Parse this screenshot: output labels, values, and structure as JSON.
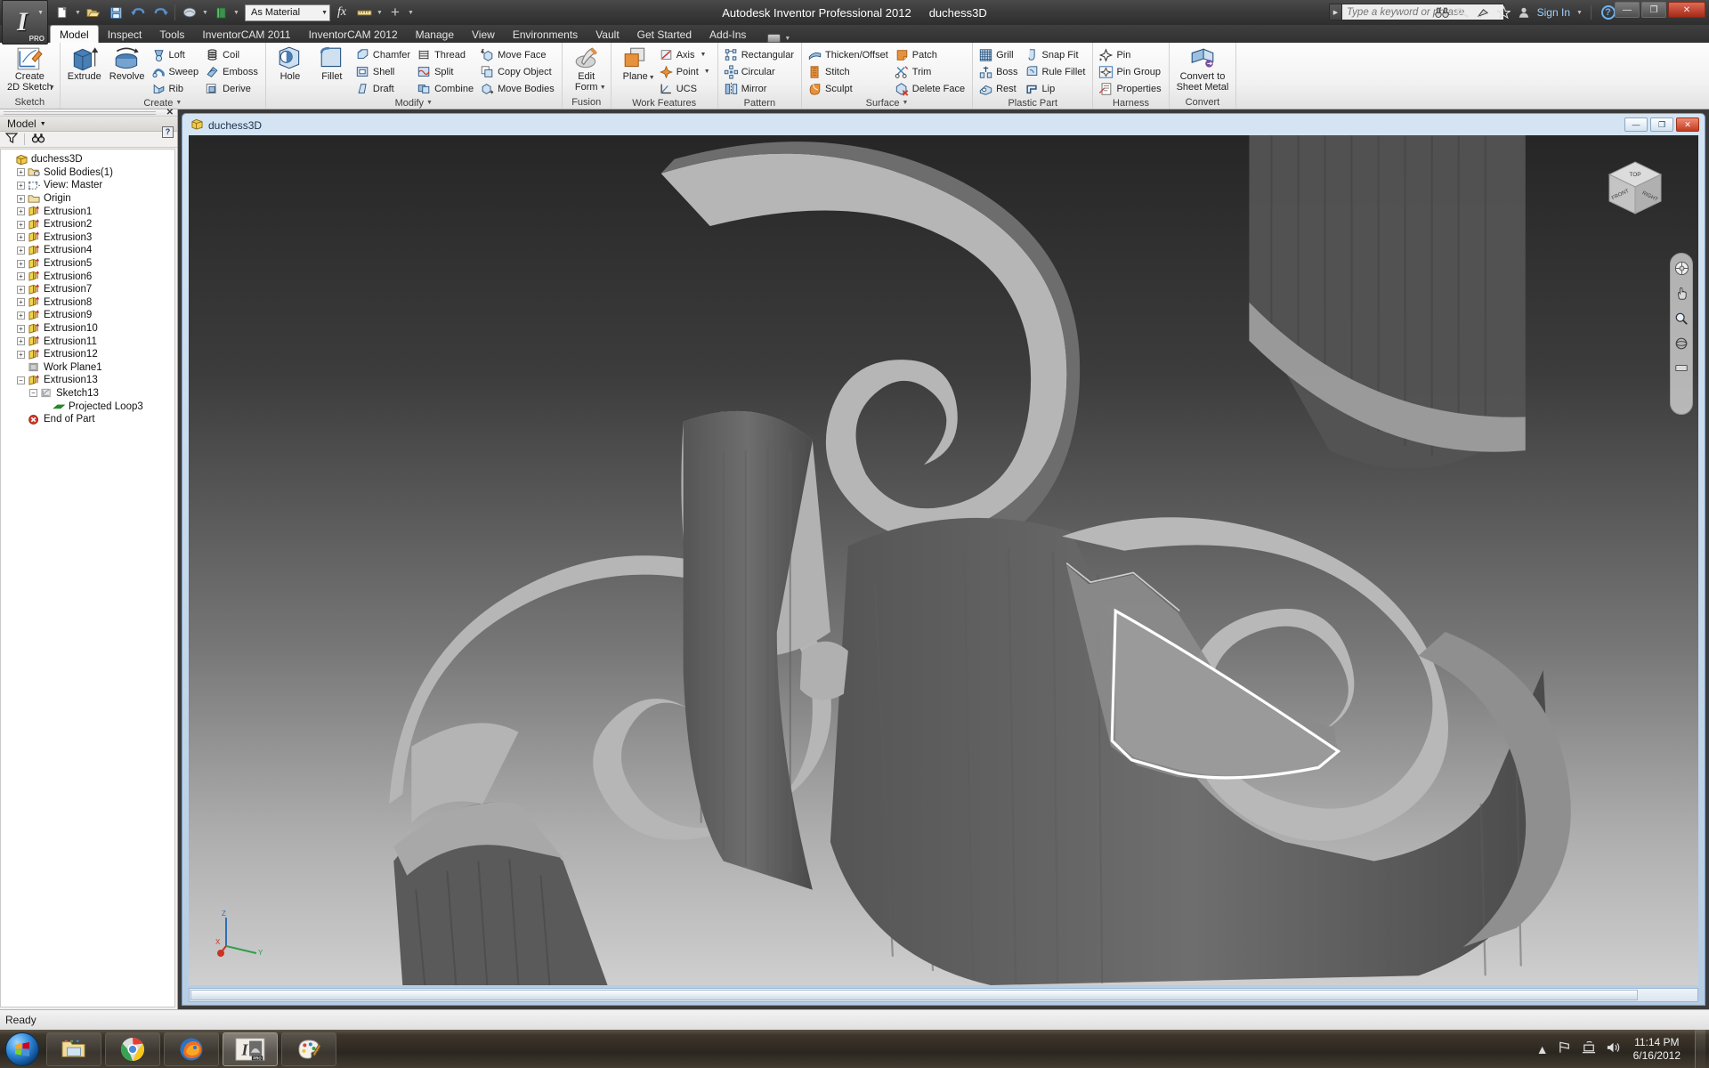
{
  "app": {
    "title_product": "Autodesk Inventor Professional 2012",
    "title_document": "duchess3D",
    "orb_label": "PRO"
  },
  "quick_access": {
    "items": [
      {
        "name": "new-file",
        "icon": "document-icon"
      },
      {
        "name": "open-file",
        "icon": "folder-open-icon"
      },
      {
        "name": "save-file",
        "icon": "floppy-disk-icon"
      },
      {
        "name": "undo",
        "icon": "undo-arrow-icon"
      },
      {
        "name": "redo",
        "icon": "redo-arrow-icon"
      },
      {
        "name": "appearance",
        "icon": "paint-icon"
      },
      {
        "name": "material-color",
        "icon": "green-book-icon"
      }
    ],
    "material_value": "As Material",
    "parameters_label": "fx",
    "measure_label": "measure-icon",
    "add_label": "+"
  },
  "search": {
    "placeholder": "Type a keyword or phrase"
  },
  "help_area": {
    "sign_in": "Sign In",
    "icons": [
      "binoculars-icon",
      "key-icon",
      "satellite-icon",
      "star-icon",
      "user-icon",
      "help-icon"
    ]
  },
  "window_buttons": {
    "minimize": "—",
    "restore": "❐",
    "close": "✕"
  },
  "tabs": [
    {
      "label": "Model",
      "active": true
    },
    {
      "label": "Inspect",
      "active": false
    },
    {
      "label": "Tools",
      "active": false
    },
    {
      "label": "InventorCAM 2011",
      "active": false
    },
    {
      "label": "InventorCAM 2012",
      "active": false
    },
    {
      "label": "Manage",
      "active": false
    },
    {
      "label": "View",
      "active": false
    },
    {
      "label": "Environments",
      "active": false
    },
    {
      "label": "Vault",
      "active": false
    },
    {
      "label": "Get Started",
      "active": false
    },
    {
      "label": "Add-Ins",
      "active": false
    }
  ],
  "ribbon": {
    "panels": [
      {
        "label": "Sketch",
        "big": [
          {
            "label": "Create\n2D Sketch",
            "icon": "sketch-icon",
            "dropdown": true
          }
        ],
        "cols": []
      },
      {
        "label": "Create",
        "dropdown": true,
        "big": [
          {
            "label": "Extrude",
            "icon": "extrude-icon"
          },
          {
            "label": "Revolve",
            "icon": "revolve-icon"
          }
        ],
        "cols": [
          [
            {
              "label": "Loft",
              "icon": "loft-icon"
            },
            {
              "label": "Sweep",
              "icon": "sweep-icon"
            },
            {
              "label": "Rib",
              "icon": "rib-icon"
            }
          ],
          [
            {
              "label": "Coil",
              "icon": "coil-icon"
            },
            {
              "label": "Emboss",
              "icon": "emboss-icon"
            },
            {
              "label": "Derive",
              "icon": "derive-icon"
            }
          ]
        ]
      },
      {
        "label": "Modify",
        "dropdown": true,
        "big": [
          {
            "label": "Hole",
            "icon": "hole-icon"
          },
          {
            "label": "Fillet",
            "icon": "fillet-icon"
          }
        ],
        "cols": [
          [
            {
              "label": "Chamfer",
              "icon": "chamfer-icon"
            },
            {
              "label": "Shell",
              "icon": "shell-icon"
            },
            {
              "label": "Draft",
              "icon": "draft-icon"
            }
          ],
          [
            {
              "label": "Thread",
              "icon": "thread-icon"
            },
            {
              "label": "Split",
              "icon": "split-icon"
            },
            {
              "label": "Combine",
              "icon": "combine-icon"
            }
          ],
          [
            {
              "label": "Move Face",
              "icon": "move-face-icon"
            },
            {
              "label": "Copy Object",
              "icon": "copy-object-icon"
            },
            {
              "label": "Move Bodies",
              "icon": "move-bodies-icon"
            }
          ]
        ]
      },
      {
        "label": "Fusion",
        "big": [
          {
            "label": "Edit\nForm",
            "icon": "edit-form-icon",
            "dropdown": true
          }
        ],
        "cols": []
      },
      {
        "label": "Work Features",
        "big": [
          {
            "label": "Plane",
            "icon": "plane-icon",
            "dropdown": true
          }
        ],
        "cols": [
          [
            {
              "label": "Axis",
              "icon": "axis-icon",
              "dropdown": true
            },
            {
              "label": "Point",
              "icon": "point-icon",
              "dropdown": true
            },
            {
              "label": "UCS",
              "icon": "ucs-icon"
            }
          ]
        ]
      },
      {
        "label": "Pattern",
        "big": [],
        "cols": [
          [
            {
              "label": "Rectangular",
              "icon": "rectangular-pattern-icon"
            },
            {
              "label": "Circular",
              "icon": "circular-pattern-icon"
            },
            {
              "label": "Mirror",
              "icon": "mirror-icon"
            }
          ]
        ]
      },
      {
        "label": "Surface",
        "dropdown": true,
        "big": [],
        "cols": [
          [
            {
              "label": "Thicken/Offset",
              "icon": "thicken-offset-icon"
            },
            {
              "label": "Stitch",
              "icon": "stitch-icon"
            },
            {
              "label": "Sculpt",
              "icon": "sculpt-icon"
            }
          ],
          [
            {
              "label": "Patch",
              "icon": "patch-icon"
            },
            {
              "label": "Trim",
              "icon": "trim-icon"
            },
            {
              "label": "Delete Face",
              "icon": "delete-face-icon"
            }
          ]
        ]
      },
      {
        "label": "Plastic Part",
        "big": [],
        "cols": [
          [
            {
              "label": "Grill",
              "icon": "grill-icon"
            },
            {
              "label": "Boss",
              "icon": "boss-icon"
            },
            {
              "label": "Rest",
              "icon": "rest-icon"
            }
          ],
          [
            {
              "label": "Snap Fit",
              "icon": "snap-fit-icon"
            },
            {
              "label": "Rule Fillet",
              "icon": "rule-fillet-icon"
            },
            {
              "label": "Lip",
              "icon": "lip-icon"
            }
          ]
        ]
      },
      {
        "label": "Harness",
        "big": [],
        "cols": [
          [
            {
              "label": "Pin",
              "icon": "pin-icon"
            },
            {
              "label": "Pin Group",
              "icon": "pin-group-icon"
            },
            {
              "label": "Properties",
              "icon": "properties-icon"
            }
          ]
        ]
      },
      {
        "label": "Convert",
        "big": [
          {
            "label": "Convert to\nSheet Metal",
            "icon": "convert-sheet-metal-icon"
          }
        ],
        "cols": []
      }
    ]
  },
  "browser": {
    "title": "Model",
    "tools": [
      "filter-icon",
      "find-icon"
    ],
    "tree": [
      {
        "label": "duchess3D",
        "depth": 0,
        "expander": "none",
        "icon": "part-icon"
      },
      {
        "label": "Solid Bodies(1)",
        "depth": 1,
        "expander": "plus",
        "icon": "solid-bodies-icon"
      },
      {
        "label": "View: Master",
        "depth": 1,
        "expander": "plus",
        "icon": "view-icon"
      },
      {
        "label": "Origin",
        "depth": 1,
        "expander": "plus",
        "icon": "folder-icon"
      },
      {
        "label": "Extrusion1",
        "depth": 1,
        "expander": "plus",
        "icon": "extrusion-icon"
      },
      {
        "label": "Extrusion2",
        "depth": 1,
        "expander": "plus",
        "icon": "extrusion-icon"
      },
      {
        "label": "Extrusion3",
        "depth": 1,
        "expander": "plus",
        "icon": "extrusion-icon"
      },
      {
        "label": "Extrusion4",
        "depth": 1,
        "expander": "plus",
        "icon": "extrusion-icon"
      },
      {
        "label": "Extrusion5",
        "depth": 1,
        "expander": "plus",
        "icon": "extrusion-icon"
      },
      {
        "label": "Extrusion6",
        "depth": 1,
        "expander": "plus",
        "icon": "extrusion-icon"
      },
      {
        "label": "Extrusion7",
        "depth": 1,
        "expander": "plus",
        "icon": "extrusion-icon"
      },
      {
        "label": "Extrusion8",
        "depth": 1,
        "expander": "plus",
        "icon": "extrusion-icon"
      },
      {
        "label": "Extrusion9",
        "depth": 1,
        "expander": "plus",
        "icon": "extrusion-icon"
      },
      {
        "label": "Extrusion10",
        "depth": 1,
        "expander": "plus",
        "icon": "extrusion-icon"
      },
      {
        "label": "Extrusion11",
        "depth": 1,
        "expander": "plus",
        "icon": "extrusion-icon"
      },
      {
        "label": "Extrusion12",
        "depth": 1,
        "expander": "plus",
        "icon": "extrusion-icon"
      },
      {
        "label": "Work Plane1",
        "depth": 1,
        "expander": "none",
        "icon": "work-plane-icon"
      },
      {
        "label": "Extrusion13",
        "depth": 1,
        "expander": "minus",
        "icon": "extrusion-icon"
      },
      {
        "label": "Sketch13",
        "depth": 2,
        "expander": "minus",
        "icon": "sketch-node-icon"
      },
      {
        "label": "Projected Loop3",
        "depth": 3,
        "expander": "none",
        "icon": "projected-loop-icon"
      },
      {
        "label": "End of Part",
        "depth": 1,
        "expander": "none",
        "icon": "end-of-part-icon"
      }
    ]
  },
  "document_window": {
    "title": "duchess3D",
    "buttons": {
      "minimize": "—",
      "restore": "❐",
      "close": "✕"
    }
  },
  "viewcube": {
    "face_top": "TOP",
    "face_front": "FRONT",
    "face_right": "RIGHT"
  },
  "navigation_bar": {
    "items": [
      "full-navigation-wheel-icon",
      "pan-icon",
      "zoom-icon",
      "orbit-icon",
      "look-at-icon"
    ]
  },
  "axis_triad": {
    "x": "X",
    "y": "Y",
    "z": "Z"
  },
  "status_bar": {
    "message": "Ready"
  },
  "taskbar": {
    "start": "start-orb-icon",
    "items": [
      {
        "name": "windows-explorer",
        "icon": "folder-icon",
        "active": false
      },
      {
        "name": "google-chrome",
        "icon": "chrome-icon",
        "active": false
      },
      {
        "name": "mozilla-firefox",
        "icon": "firefox-icon",
        "active": false
      },
      {
        "name": "autodesk-inventor",
        "icon": "inventor-icon",
        "active": true
      },
      {
        "name": "paint",
        "icon": "paint-palette-icon",
        "active": false
      }
    ],
    "tray": [
      "show-hidden-icons-icon",
      "flag-action-center-icon",
      "network-icon",
      "volume-icon"
    ],
    "clock_time": "11:14 PM",
    "clock_date": "6/16/2012"
  },
  "colors": {
    "accent_blue": "#2f6fb5",
    "ribbon_bg": "#f2f2f2",
    "title_bg": "#3b3b3b",
    "canvas_dark": "#2a2a2a",
    "canvas_light": "#c9c9c9",
    "model_light_face": "#b4b4b4",
    "model_dark_face": "#5b5b5b",
    "highlight_outline": "#ffffff"
  }
}
